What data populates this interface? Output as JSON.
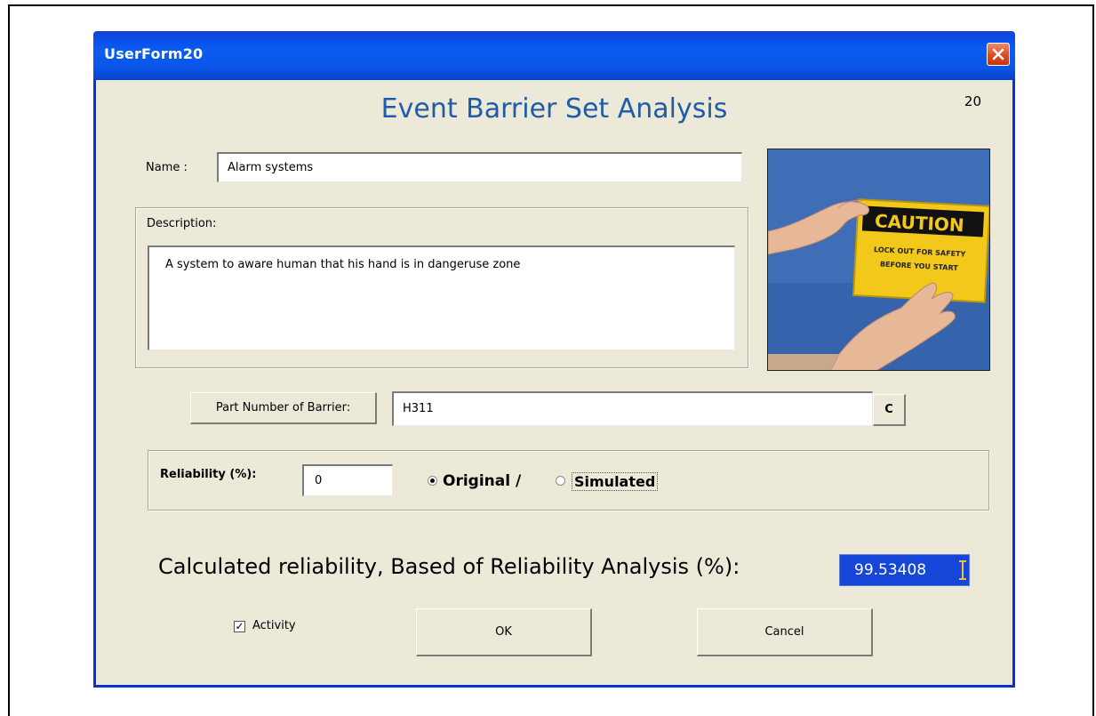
{
  "window": {
    "title": "UserForm20"
  },
  "heading": "Event Barrier Set Analysis",
  "form_number": "20",
  "name": {
    "label": "Name :",
    "value": "Alarm systems"
  },
  "description": {
    "label": "Description:",
    "value": "A system to aware human that his hand is in dangeruse zone"
  },
  "image": {
    "sign_title": "CAUTION",
    "sign_line1": "LOCK OUT FOR SAFETY",
    "sign_line2": "BEFORE YOU START"
  },
  "part_number": {
    "button_label": "Part Number of Barrier:",
    "value": "H311",
    "small_button_label": "C"
  },
  "reliability": {
    "label": "Reliability (%):",
    "value": "0",
    "option_original": "Original /",
    "option_simulated": "Simulated",
    "selected": "original"
  },
  "calculated": {
    "label": "Calculated reliability, Based of Reliability Analysis (%):",
    "value": "99.53408"
  },
  "activity": {
    "label": "Activity",
    "checked": true
  },
  "buttons": {
    "ok": "OK",
    "cancel": "Cancel"
  },
  "colors": {
    "title_bar": "#0a55e8",
    "heading_text": "#1f5ca8",
    "calc_highlight": "#1546d8",
    "dialog_bg": "#ece9d8"
  },
  "icons": {
    "close": "close-icon",
    "caution_photo": "caution-sign-photo"
  }
}
